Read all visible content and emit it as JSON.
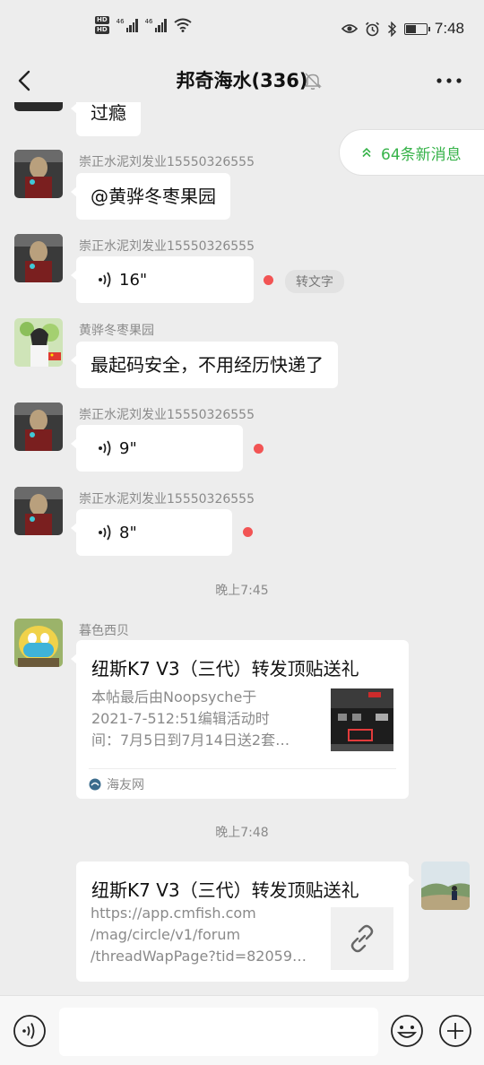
{
  "status_bar": {
    "hd_badges": [
      "HD",
      "HD"
    ],
    "signal_tags": [
      "46",
      "46"
    ],
    "time": "7:48",
    "battery_level": 0.55,
    "icons": [
      "wifi-icon",
      "eye-icon",
      "alarm-icon",
      "bluetooth-icon",
      "battery-icon"
    ]
  },
  "nav": {
    "title": "邦奇海水(336)",
    "back_icon": "back-arrow-icon",
    "mute_icon": "bell-off-icon",
    "more_icon": "more-icon"
  },
  "new_messages": {
    "label": "64条新消息",
    "icon": "double-chevron-up-icon",
    "accent": "#37b34a"
  },
  "messages": [
    {
      "type": "text",
      "text": "过瘾",
      "partial": true
    },
    {
      "type": "text",
      "sender": "崇正水泥刘发业15550326555",
      "text": "@黄骅冬枣果园"
    },
    {
      "type": "voice",
      "sender": "崇正水泥刘发业15550326555",
      "duration": "16\"",
      "unread": true,
      "transcribe_label": "转文字"
    },
    {
      "type": "text",
      "sender": "黄骅冬枣果园",
      "text": "最起码安全，不用经历快递了"
    },
    {
      "type": "voice",
      "sender": "崇正水泥刘发业15550326555",
      "duration": "9\"",
      "unread": true
    },
    {
      "type": "voice",
      "sender": "崇正水泥刘发业15550326555",
      "duration": "8\"",
      "unread": true
    },
    {
      "type": "time",
      "text": "晚上7:45"
    },
    {
      "type": "link",
      "sender": "暮色西贝",
      "title": "纽斯K7 V3（三代）转发顶贴送礼",
      "desc": [
        "本帖最后由Noopsyche于",
        "2021-7-512:51编辑活动时",
        "间：7月5日到7月14日送2套…"
      ],
      "source": "海友网"
    },
    {
      "type": "time",
      "text": "晚上7:48"
    },
    {
      "type": "link",
      "self": true,
      "title": "纽斯K7 V3（三代）转发顶贴送礼",
      "desc": [
        "https://app.cmfish.com",
        "/mag/circle/v1/forum",
        "/threadWapPage?tid=82059…"
      ]
    }
  ],
  "bottom": {
    "voice_icon": "voice-input-icon",
    "emoji_icon": "emoji-icon",
    "plus_icon": "plus-icon"
  }
}
